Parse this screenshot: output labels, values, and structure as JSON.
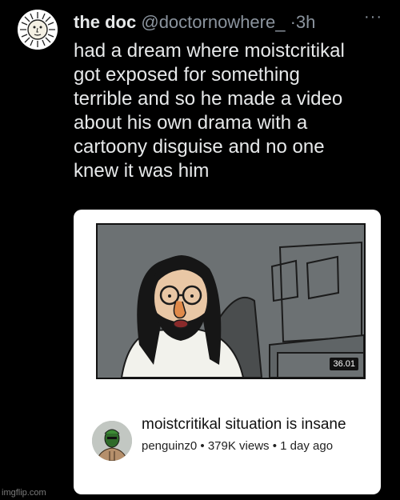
{
  "tweet": {
    "author_name": "the doc",
    "handle": "@doctornowhere_",
    "separator": "·",
    "time": "3h",
    "more_label": "···",
    "text_lines": [
      "had a dream where moistcritikal",
      "got exposed for something",
      "terrible and so he made a video",
      "about his own drama with a",
      "cartoony disguise and no one",
      "knew it was him"
    ]
  },
  "video": {
    "duration": "36.01",
    "title": "moistcritikal situation is insane",
    "channel": "penguinz0",
    "views": "379K views",
    "age": "1 day ago",
    "meta_separator": "•"
  },
  "watermark": "imgflip.com",
  "icons": {
    "author_avatar": "sun-face-avatar-icon",
    "channel_avatar": "green-masked-figure-avatar-icon",
    "more": "more-options-icon"
  },
  "colors": {
    "background": "#000000",
    "text_primary": "#e7e9ea",
    "text_secondary": "#8b949e",
    "card": "#ffffff",
    "thumb_bg": "#6b7072"
  }
}
